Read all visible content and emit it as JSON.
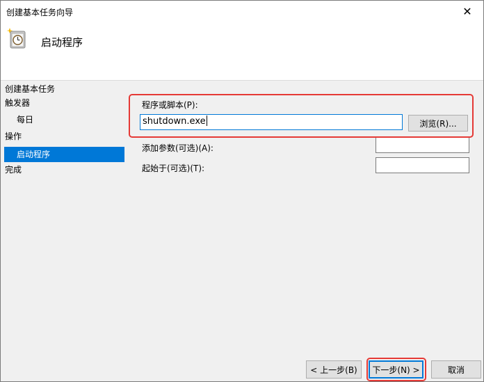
{
  "window": {
    "title": "创建基本任务向导",
    "close_glyph": "✕"
  },
  "header": {
    "icon": "task-clock-icon",
    "title": "启动程序"
  },
  "sidebar": {
    "items": [
      {
        "label": "创建基本任务",
        "active": false
      },
      {
        "label": "触发器",
        "active": false
      },
      {
        "label": "每日",
        "active": false
      },
      {
        "label": "操作",
        "active": false
      },
      {
        "label": "启动程序",
        "active": true
      },
      {
        "label": "完成",
        "active": false
      }
    ]
  },
  "form": {
    "program_label": "程序或脚本(P):",
    "program_value": "shutdown.exe",
    "browse_label": "浏览(R)...",
    "args_label": "添加参数(可选)(A):",
    "args_value": "",
    "startin_label": "起始于(可选)(T):",
    "startin_value": ""
  },
  "footer": {
    "back_label": "< 上一步(B)",
    "next_label": "下一步(N) >",
    "cancel_label": "取消"
  },
  "colors": {
    "accent": "#0078d7",
    "highlight": "#e53935"
  }
}
